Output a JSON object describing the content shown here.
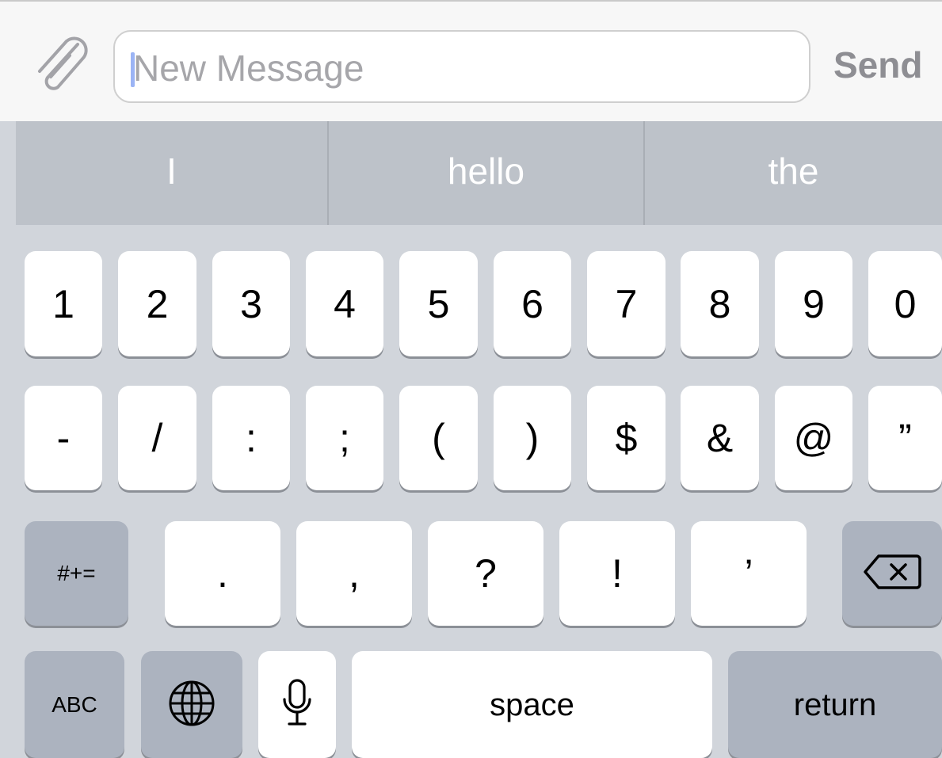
{
  "composer": {
    "attach_icon": "paperclip-icon",
    "placeholder": "New Message",
    "send_label": "Send"
  },
  "suggestions": [
    "I",
    "hello",
    "the"
  ],
  "keyboard": {
    "row1": [
      "1",
      "2",
      "3",
      "4",
      "5",
      "6",
      "7",
      "8",
      "9",
      "0"
    ],
    "row2": [
      "-",
      "/",
      ":",
      ";",
      "(",
      ")",
      "$",
      "&",
      "@",
      "”"
    ],
    "row3": {
      "left": "#+=",
      "keys": [
        ".",
        ",",
        "?",
        "!",
        "’"
      ],
      "backspace_icon": "backspace-icon"
    },
    "row4": {
      "abc": "ABC",
      "globe_icon": "globe-icon",
      "mic_icon": "microphone-icon",
      "space": "space",
      "return": "return"
    }
  },
  "colors": {
    "keyboard_bg": "#d1d5db",
    "suggestion_bar": "#bdc2c9",
    "function_key": "#acb3bf",
    "caret": "#9bb4f5"
  }
}
